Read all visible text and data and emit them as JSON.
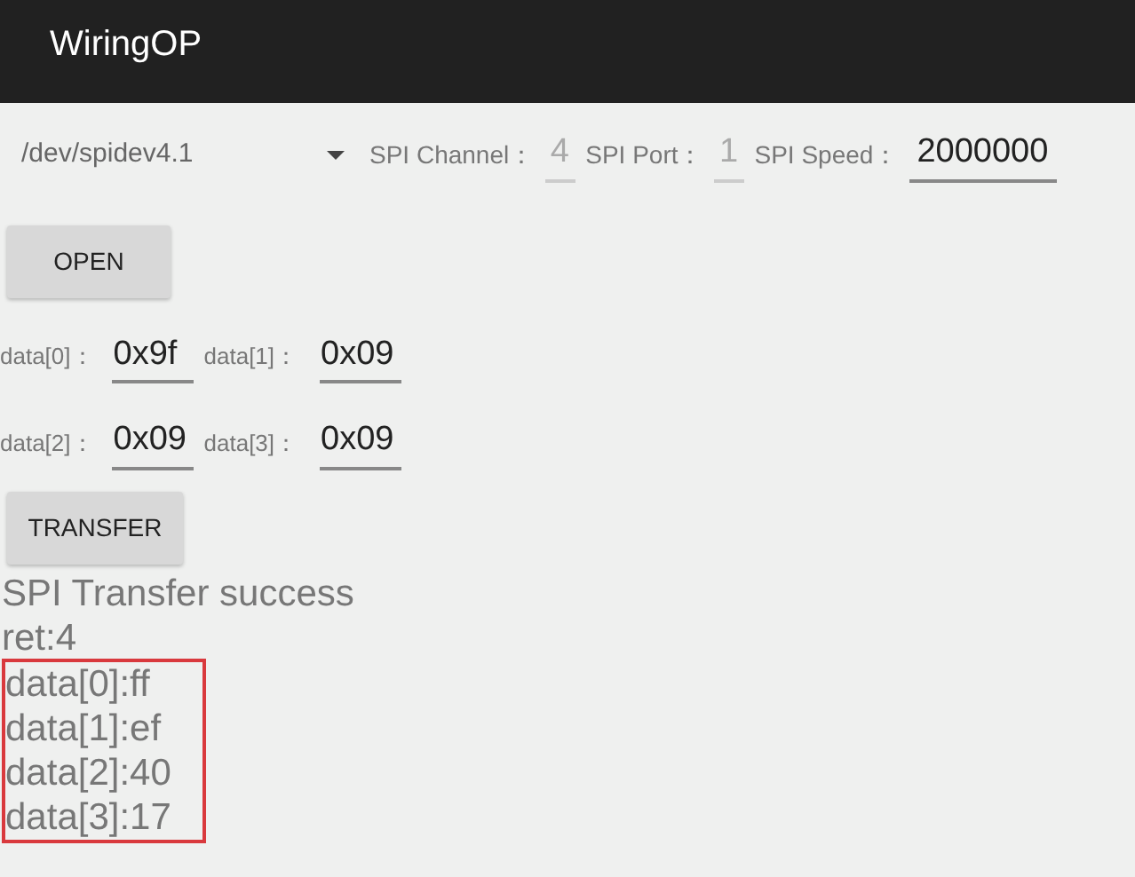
{
  "app_bar": {
    "title": "WiringOP"
  },
  "config": {
    "device": "/dev/spidev4.1",
    "fields": [
      {
        "label": "SPI Channel：",
        "value": "4",
        "disabled": true
      },
      {
        "label": "SPI Port：",
        "value": "1",
        "disabled": true
      },
      {
        "label": "SPI Speed：",
        "value": "2000000",
        "disabled": false
      }
    ]
  },
  "open_button": "OPEN",
  "data_rows": [
    [
      {
        "label": "data[0]：",
        "value": "0x9f"
      },
      {
        "label": "data[1]：",
        "value": "0x09"
      }
    ],
    [
      {
        "label": "data[2]：",
        "value": "0x09"
      },
      {
        "label": "data[3]：",
        "value": "0x09"
      }
    ]
  ],
  "transfer_button": "TRANSFER",
  "output": {
    "lines": [
      "SPI Transfer success",
      "ret:4"
    ],
    "highlighted_lines": [
      "data[0]:ff",
      "data[1]:ef",
      "data[2]:40",
      "data[3]:17"
    ],
    "highlighted": true
  }
}
